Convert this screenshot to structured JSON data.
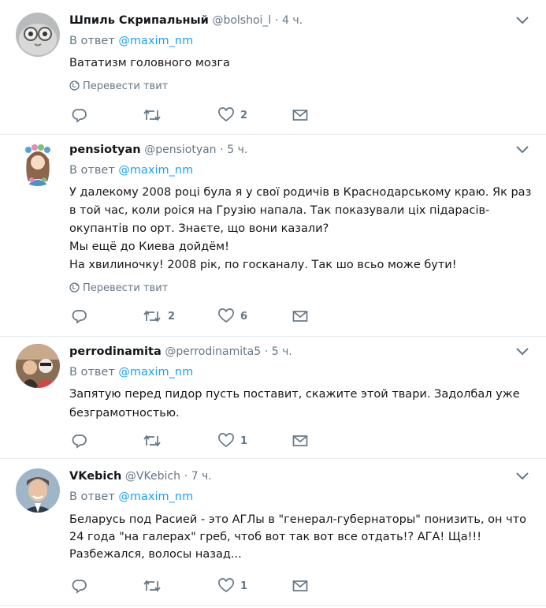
{
  "common": {
    "reply_prefix": "В ответ",
    "reply_user": "@maxim_nm",
    "translate_label": "Перевести твит",
    "dot": "·"
  },
  "tweets": [
    {
      "name": "Шпиль Скрипальный",
      "handle": "@bolshoi_l",
      "time": "4 ч.",
      "lines": [
        "Вататизм головного мозга"
      ],
      "show_translate": true,
      "retweets": "",
      "likes": "2"
    },
    {
      "name": "pensiotyan",
      "handle": "@pensiotyan",
      "time": "5 ч.",
      "lines": [
        "У далекому 2008 році була я у свої родичів в Краснодарському краю. Як раз",
        "в той час, коли роіся на Грузію напала. Так показували ціх підарасів-",
        "окупантів по орт. Знаєте, що вони казали?",
        "Мы ещё до Киева дойдём!",
        "На хвилиночку! 2008 рік, по госканалу. Так шо всьо може бути!"
      ],
      "show_translate": true,
      "retweets": "2",
      "likes": "6"
    },
    {
      "name": "perrodinamita",
      "handle": "@perrodinamita5",
      "time": "5 ч.",
      "lines": [
        "Запятую перед пидор пусть поставит, скажите этой твари. Задолбал уже",
        "безграмотностью."
      ],
      "show_translate": false,
      "retweets": "",
      "likes": "1"
    },
    {
      "name": "VKebich",
      "handle": "@VKebich",
      "time": "7 ч.",
      "lines": [
        "Беларусь под Расией - это АГЛы в \"генерал-губернаторы\" понизить, он что",
        "24 года \"на галерах\" греб, чтоб вот так вот все отдать!? АГА! Ща!!!",
        "Разбежался, волосы назад..."
      ],
      "show_translate": false,
      "retweets": "",
      "likes": "1"
    }
  ]
}
